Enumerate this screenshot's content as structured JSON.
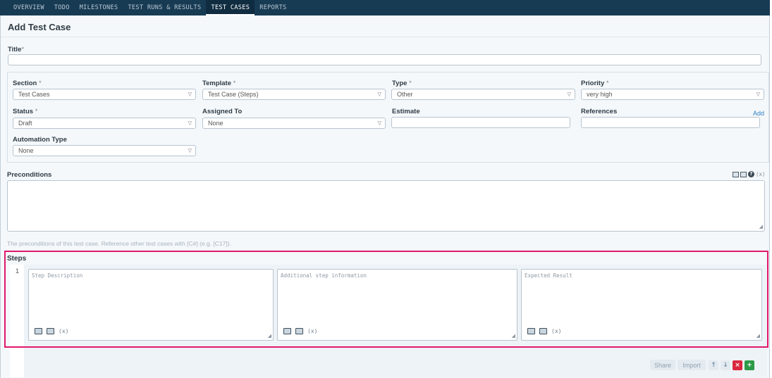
{
  "nav": {
    "tabs": [
      {
        "label": "OVERVIEW"
      },
      {
        "label": "TODO"
      },
      {
        "label": "MILESTONES"
      },
      {
        "label": "TEST RUNS & RESULTS"
      },
      {
        "label": "TEST CASES"
      },
      {
        "label": "REPORTS"
      }
    ],
    "active": "TEST CASES"
  },
  "page": {
    "title": "Add Test Case"
  },
  "form": {
    "title_label": "Title",
    "required_mark": "*",
    "section": {
      "label": "Section",
      "value": "Test Cases"
    },
    "template": {
      "label": "Template",
      "value": "Test Case (Steps)"
    },
    "type": {
      "label": "Type",
      "value": "Other"
    },
    "priority": {
      "label": "Priority",
      "value": "very high"
    },
    "status": {
      "label": "Status",
      "value": "Draft"
    },
    "assigned_to": {
      "label": "Assigned To",
      "value": "None"
    },
    "estimate": {
      "label": "Estimate",
      "value": ""
    },
    "references": {
      "label": "References",
      "value": "",
      "add_link": "Add"
    },
    "automation_type": {
      "label": "Automation Type",
      "value": "None"
    },
    "preconditions": {
      "label": "Preconditions",
      "hint": "The preconditions of this test case. Reference other test cases with [C#] (e.g. [C17])."
    },
    "steps": {
      "label": "Steps",
      "rows": [
        {
          "number": "1",
          "description_placeholder": "Step Description",
          "additional_placeholder": "Additional step information",
          "expected_placeholder": "Expected Result"
        }
      ]
    }
  },
  "actions": {
    "share": "Share",
    "import": "Import",
    "move_up": "↑",
    "move_down": "↓",
    "delete": "×",
    "add": "+"
  },
  "colors": {
    "nav_bg": "#183b54",
    "highlight": "#e0186c",
    "delete": "#d9273e",
    "add": "#2c9a48"
  },
  "icons": [
    "image-icon",
    "table-icon",
    "help-icon",
    "variable-icon",
    "resize-icon",
    "caret-down-icon"
  ]
}
